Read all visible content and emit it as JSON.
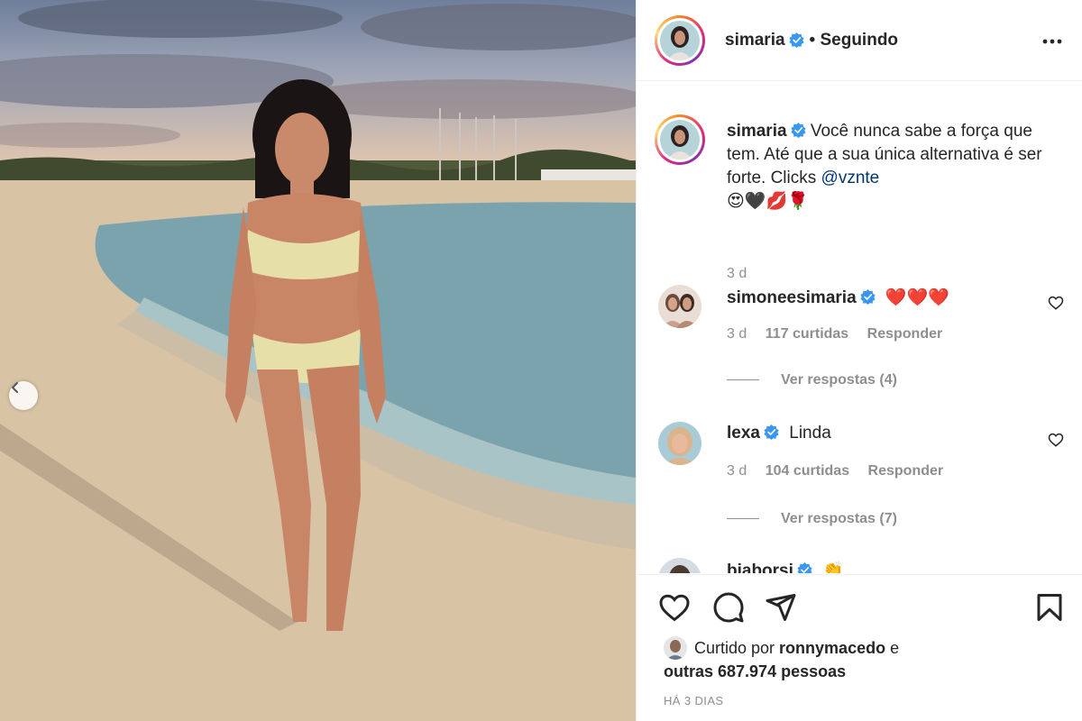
{
  "post": {
    "author": "simaria",
    "follow_state": "• Seguindo",
    "caption_text": "Você nunca sabe a força que tem. Até que a sua única alternativa é ser forte. Clicks ",
    "caption_mention": "@vznte",
    "caption_emojis": "😍🖤💋🌹",
    "caption_time": "3 d",
    "liked_by_prefix": "Curtido por ",
    "liked_by_user": "ronnymacedo",
    "liked_by_mid": " e",
    "liked_by_others": "outras 687.974 pessoas",
    "date": "HÁ 3 DIAS"
  },
  "comments": [
    {
      "user": "simoneesimaria",
      "text": "❤️❤️❤️",
      "time": "3 d",
      "likes": "117 curtidas",
      "reply_label": "Responder",
      "view_replies": "Ver respostas (4)"
    },
    {
      "user": "lexa",
      "text": "Linda",
      "time": "3 d",
      "likes": "104 curtidas",
      "reply_label": "Responder",
      "view_replies": "Ver respostas (7)"
    },
    {
      "user": "biaborsi",
      "text": "👏"
    }
  ],
  "icons": {
    "verified": "verified-badge-icon",
    "more": "more-options-icon",
    "like": "heart-icon",
    "comment": "comment-bubble-icon",
    "share": "paper-plane-icon",
    "save": "bookmark-icon",
    "carousel_prev": "chevron-left-icon"
  },
  "colors": {
    "verified_blue": "#3897f0",
    "link": "#00376b",
    "muted": "#8e8e8e"
  }
}
